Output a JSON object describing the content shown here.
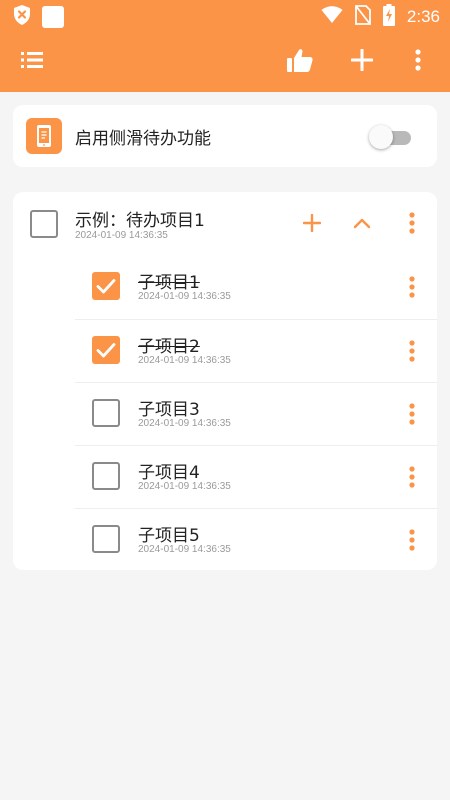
{
  "colors": {
    "accent": "#fb9447",
    "surface": "#ffffff",
    "background": "#f5f5f5"
  },
  "status_bar": {
    "time": "2:36",
    "icons": [
      "shield-icon",
      "notification-square-icon",
      "wifi-icon",
      "no-sim-icon",
      "battery-charging-icon"
    ]
  },
  "app_bar": {
    "actions": [
      "list-icon",
      "thumbs-up-icon",
      "add-icon",
      "more-vert-icon"
    ]
  },
  "sidebar_toggle": {
    "label": "启用侧滑待办功能",
    "enabled": false
  },
  "parent_todo": {
    "title": "示例：待办项目1",
    "timestamp": "2024-01-09 14:36:35",
    "checked": false,
    "expanded": true
  },
  "children": [
    {
      "title": "子项目1",
      "timestamp": "2024-01-09 14:36:35",
      "checked": true
    },
    {
      "title": "子项目2",
      "timestamp": "2024-01-09 14:36:35",
      "checked": true
    },
    {
      "title": "子项目3",
      "timestamp": "2024-01-09 14:36:35",
      "checked": false
    },
    {
      "title": "子项目4",
      "timestamp": "2024-01-09 14:36:35",
      "checked": false
    },
    {
      "title": "子项目5",
      "timestamp": "2024-01-09 14:36:35",
      "checked": false
    }
  ]
}
